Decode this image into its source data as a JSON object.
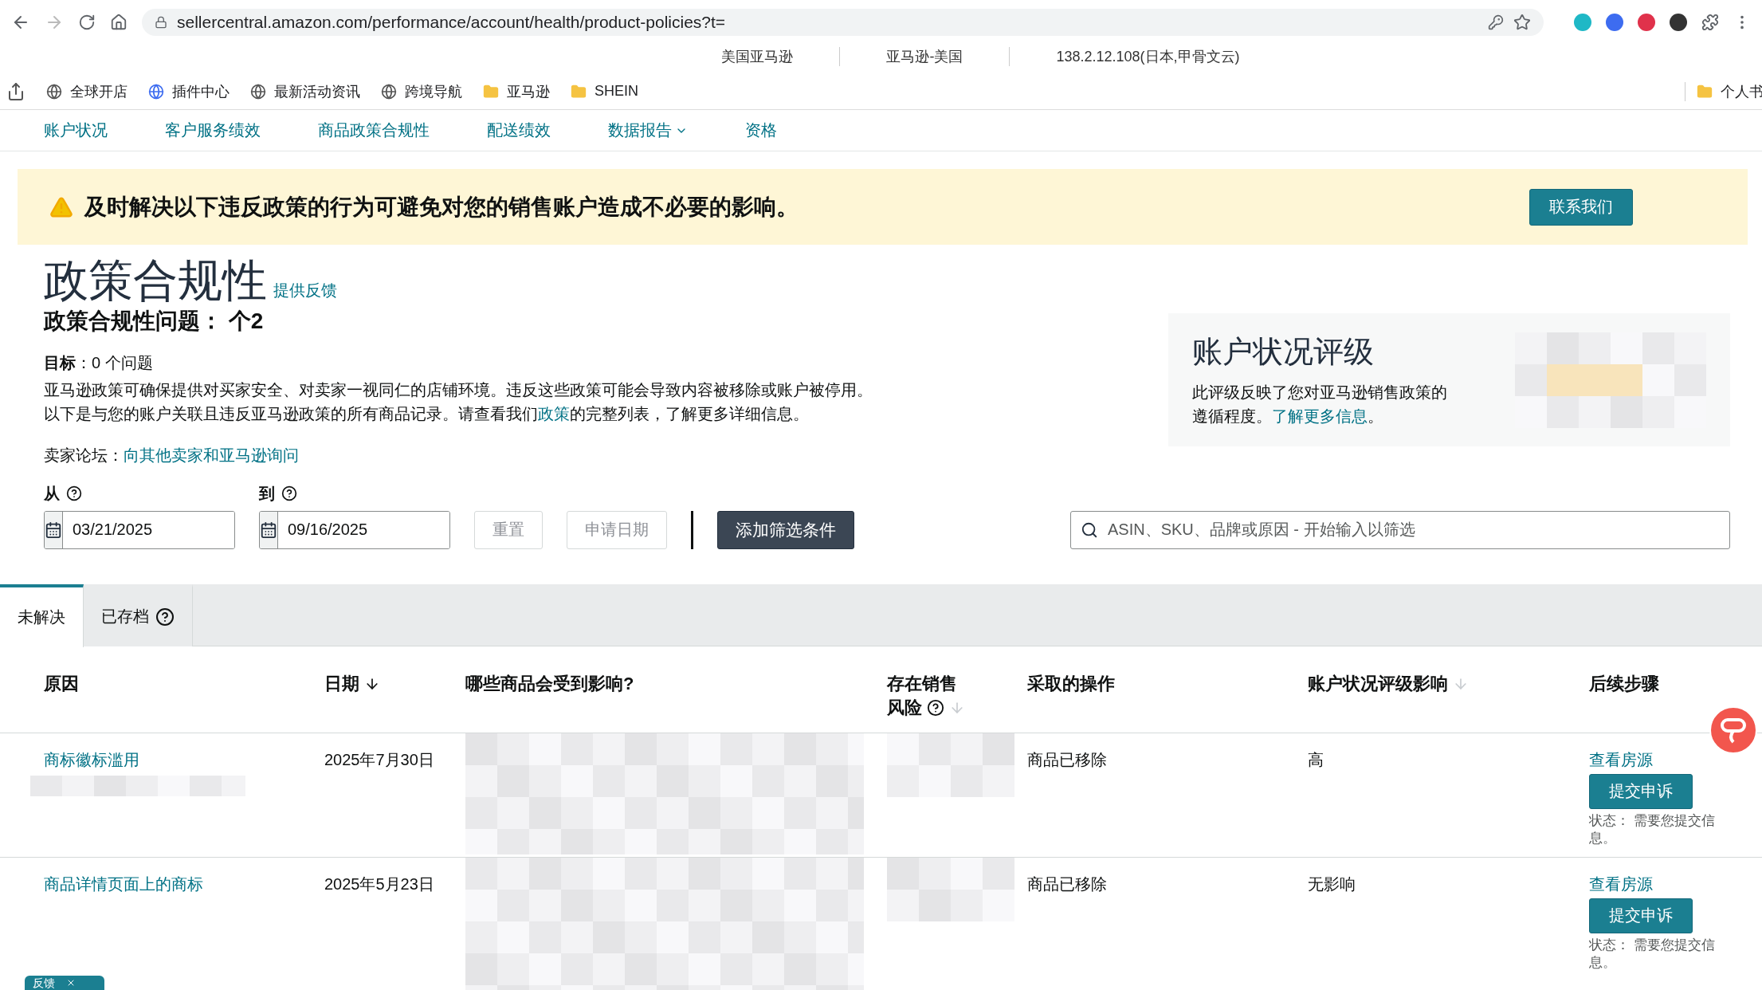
{
  "browser": {
    "url": "sellercentral.amazon.com/performance/account/health/product-policies?t=",
    "info_bar": [
      "美国亚马逊",
      "亚马逊-美国",
      "138.2.12.108(日本,甲骨文云)"
    ],
    "bookmarks": [
      {
        "label": "全球开店",
        "kind": "globe"
      },
      {
        "label": "插件中心",
        "kind": "plugin"
      },
      {
        "label": "最新活动资讯",
        "kind": "globe"
      },
      {
        "label": "跨境导航",
        "kind": "globe"
      },
      {
        "label": "亚马逊",
        "kind": "folder"
      },
      {
        "label": "SHEIN",
        "kind": "folder"
      }
    ],
    "bookmark_right": "个人书"
  },
  "nav": [
    {
      "label": "账户状况",
      "kind": "link"
    },
    {
      "label": "客户服务绩效",
      "kind": "link"
    },
    {
      "label": "商品政策合规性",
      "kind": "link"
    },
    {
      "label": "配送绩效",
      "kind": "link"
    },
    {
      "label": "数据报告",
      "kind": "dropdown"
    },
    {
      "label": "资格",
      "kind": "link"
    }
  ],
  "banner": {
    "text": "及时解决以下违反政策的行为可避免对您的销售账户造成不必要的影响。",
    "button": "联系我们"
  },
  "header": {
    "title": "政策合规性",
    "feedback_link": "提供反馈",
    "issues": "政策合规性问题： 个2",
    "target": "**目标**：0 个问题",
    "description_before": "亚马逊政策可确保提供对买家安全、对卖家一视同仁的店铺环境。违反这些政策可能会导致内容被移除或账户被停用。以下是与您的账户关联且违反亚马逊政策的所有商品记录。请查看我们",
    "description_link": "政策",
    "description_after": "的完整列表，了解更多详细信息。",
    "forum_label": "卖家论坛：",
    "forum_link": "向其他卖家和亚马逊询问"
  },
  "rating_card": {
    "title": "账户状况评级",
    "text": "此评级反映了您对亚马逊销售政策的遵循程度。",
    "link": "了解更多信息",
    "suffix": "。"
  },
  "filters": {
    "from_label": "从",
    "from_value": "03/21/2025",
    "to_label": "到",
    "to_value": "09/16/2025",
    "buttons": [
      {
        "label": "重置",
        "disabled": true
      },
      {
        "label": "申请日期",
        "disabled": true
      }
    ],
    "add_filter": "添加筛选条件",
    "search_placeholder": "ASIN、SKU、品牌或原因 - 开始输入以筛选"
  },
  "tabs": [
    {
      "label": "未解决",
      "selected": true,
      "help": false
    },
    {
      "label": "已存档",
      "selected": false,
      "help": true
    }
  ],
  "table": {
    "columns": [
      {
        "label": "原因",
        "sortable": false,
        "help": false
      },
      {
        "label": "日期",
        "sortable": true,
        "sorted": true,
        "help": false
      },
      {
        "label": "哪些商品会受到影响?",
        "sortable": false,
        "help": false
      },
      {
        "label": "存在销售风险",
        "sortable": true,
        "sorted": false,
        "help": true
      },
      {
        "label": "采取的操作",
        "sortable": false,
        "help": false
      },
      {
        "label": "账户状况评级影响",
        "sortable": true,
        "sorted": false,
        "help": false
      },
      {
        "label": "后续步骤",
        "sortable": false,
        "help": false
      }
    ],
    "rows": [
      {
        "reason": "商标徽标滥用",
        "date": "2025年7月30日",
        "action": "商品已移除",
        "impact": "高",
        "next_link": "查看房源",
        "button": "提交申诉",
        "status": "状态： 需要您提交信息。"
      },
      {
        "reason": "商品详情页面上的商标",
        "date": "2025年5月23日",
        "action": "商品已移除",
        "impact": "无影响",
        "next_link": "查看房源",
        "button": "提交申诉",
        "status": "状态： 需要您提交信息。"
      }
    ]
  },
  "feedback_tab": "反馈"
}
